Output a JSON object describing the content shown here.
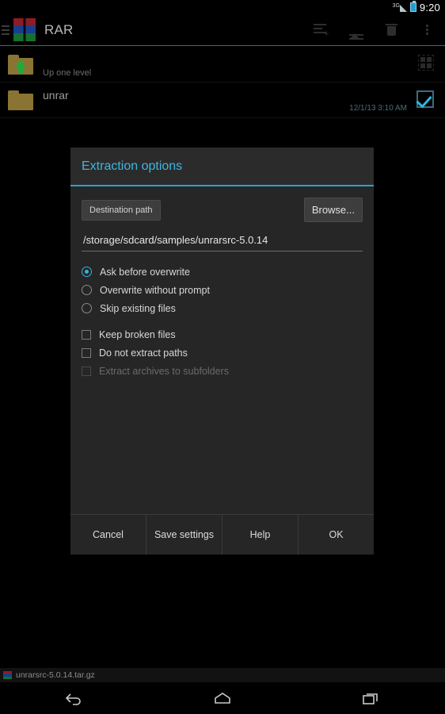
{
  "statusbar": {
    "network_label": "3G",
    "signal_icon": "signal-bars-icon",
    "battery_icon": "battery-icon",
    "clock": "9:20"
  },
  "actionbar": {
    "app_icon": "rar-app-icon",
    "title": "RAR",
    "actions": [
      {
        "name": "add-to-archive-icon",
        "label": "Add"
      },
      {
        "name": "extract-icon",
        "label": "Extract"
      },
      {
        "name": "delete-icon",
        "label": "Delete"
      },
      {
        "name": "overflow-menu-icon",
        "label": "More options"
      }
    ]
  },
  "filelist": {
    "rows": [
      {
        "icon": "folder-up-icon",
        "label": "Up one level",
        "date": "",
        "right_icon": "select-all-grid-icon"
      },
      {
        "icon": "folder-icon",
        "label": "unrar",
        "date": "12/1/13 3:10 AM",
        "right_icon": "checked-checkbox-icon"
      }
    ]
  },
  "dialog": {
    "title": "Extraction options",
    "accent_color": "#2e9fd0",
    "destination_button_label": "Destination path",
    "browse_button_label": "Browse...",
    "path_value": "/storage/sdcard/samples/unrarsrc-5.0.14",
    "path_placeholder": "/storage/sdcard",
    "overwrite_options": [
      {
        "label": "Ask before overwrite",
        "selected": true
      },
      {
        "label": "Overwrite without prompt",
        "selected": false
      },
      {
        "label": "Skip existing files",
        "selected": false
      }
    ],
    "checkboxes": [
      {
        "label": "Keep broken files",
        "checked": false,
        "disabled": false
      },
      {
        "label": "Do not extract paths",
        "checked": false,
        "disabled": false
      },
      {
        "label": "Extract archives to subfolders",
        "checked": false,
        "disabled": true
      }
    ],
    "footer_buttons": [
      {
        "label": "Cancel"
      },
      {
        "label": "Save settings"
      },
      {
        "label": "Help"
      },
      {
        "label": "OK"
      }
    ]
  },
  "bottom_status": {
    "icon": "rar-file-icon",
    "text": "unrarsrc-5.0.14.tar.gz"
  },
  "navbar": {
    "buttons": [
      {
        "name": "nav-back-icon",
        "label": "Back"
      },
      {
        "name": "nav-home-icon",
        "label": "Home"
      },
      {
        "name": "nav-recents-icon",
        "label": "Recent apps"
      }
    ]
  }
}
